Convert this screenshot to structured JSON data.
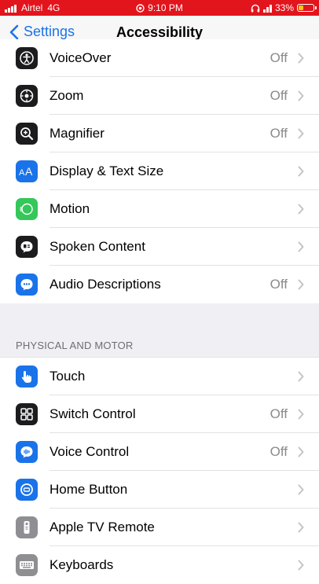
{
  "status": {
    "carrier": "Airtel",
    "network": "4G",
    "time": "9:10 PM",
    "battery": "33%"
  },
  "nav": {
    "back_label": "Settings",
    "title": "Accessibility"
  },
  "vision_items": [
    {
      "label": "VoiceOver",
      "value": "Off",
      "icon": "voiceover-icon",
      "color": "#1c1c1e"
    },
    {
      "label": "Zoom",
      "value": "Off",
      "icon": "zoom-icon",
      "color": "#1c1c1e"
    },
    {
      "label": "Magnifier",
      "value": "Off",
      "icon": "magnifier-icon",
      "color": "#1c1c1e"
    },
    {
      "label": "Display & Text Size",
      "value": "",
      "icon": "display-text-size-icon",
      "color": "#1a73e8"
    },
    {
      "label": "Motion",
      "value": "",
      "icon": "motion-icon",
      "color": "#34c759"
    },
    {
      "label": "Spoken Content",
      "value": "",
      "icon": "spoken-content-icon",
      "color": "#1c1c1e"
    },
    {
      "label": "Audio Descriptions",
      "value": "Off",
      "icon": "audio-descriptions-icon",
      "color": "#1a73e8"
    }
  ],
  "physical_section": {
    "header": "PHYSICAL AND MOTOR",
    "items": [
      {
        "label": "Touch",
        "value": "",
        "icon": "touch-icon",
        "color": "#1a73e8"
      },
      {
        "label": "Switch Control",
        "value": "Off",
        "icon": "switch-control-icon",
        "color": "#1c1c1e"
      },
      {
        "label": "Voice Control",
        "value": "Off",
        "icon": "voice-control-icon",
        "color": "#1a73e8"
      },
      {
        "label": "Home Button",
        "value": "",
        "icon": "home-button-icon",
        "color": "#1a73e8"
      },
      {
        "label": "Apple TV Remote",
        "value": "",
        "icon": "apple-tv-remote-icon",
        "color": "#8e8e93"
      },
      {
        "label": "Keyboards",
        "value": "",
        "icon": "keyboard-icon",
        "color": "#8e8e93"
      }
    ]
  }
}
